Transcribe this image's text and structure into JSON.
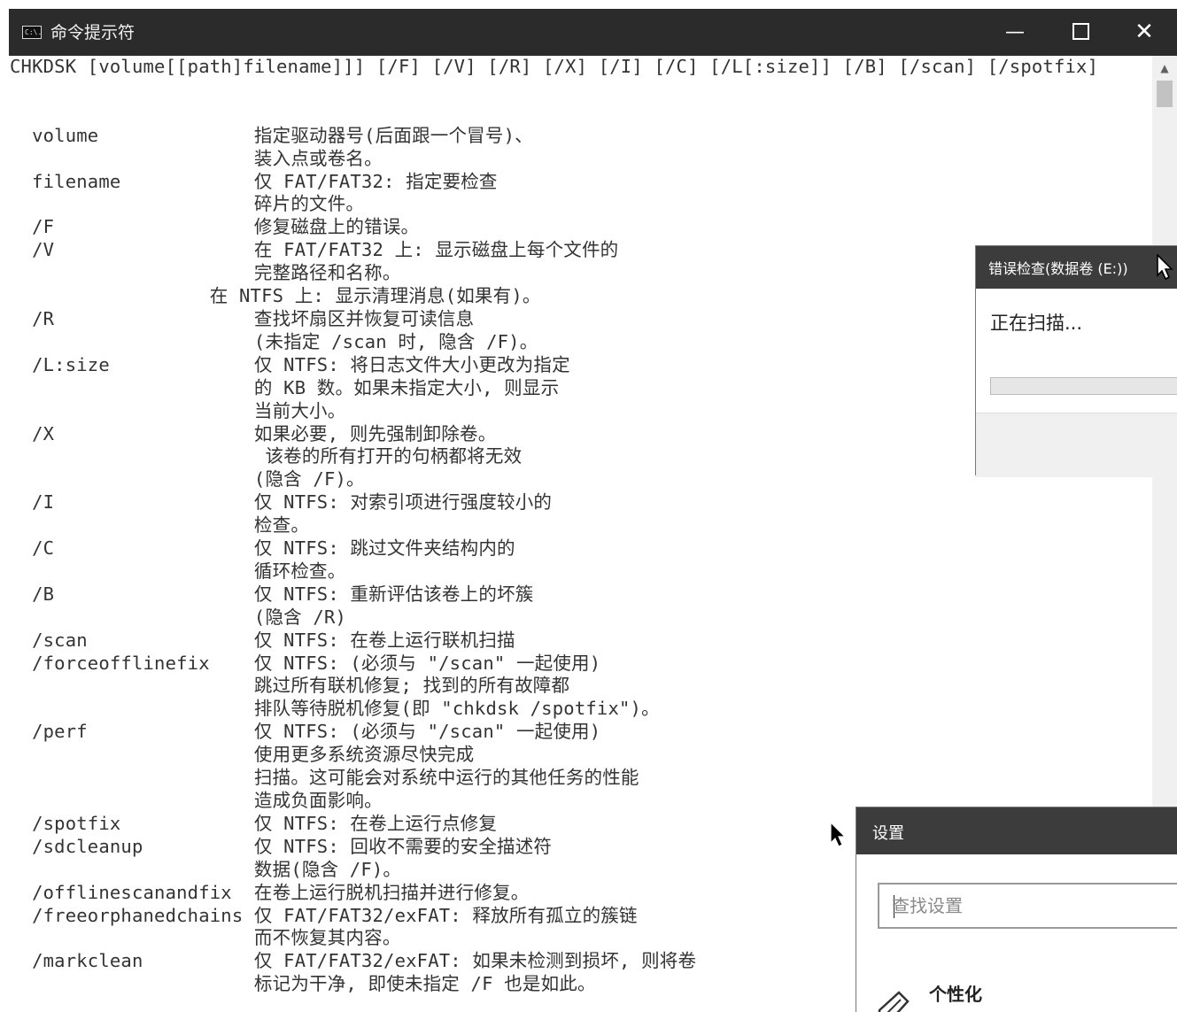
{
  "window": {
    "icon_text": "C:\\.",
    "title": "命令提示符",
    "minimize_glyph": "—",
    "close_glyph": "✕"
  },
  "console": {
    "lines": [
      "CHKDSK [volume[[path]filename]]] [/F] [/V] [/R] [/X] [/I] [/C] [/L[:size]] [/B] [/scan] [/spotfix]",
      "",
      "",
      "  volume              指定驱动器号(后面跟一个冒号)、",
      "                      装入点或卷名。",
      "  filename            仅 FAT/FAT32: 指定要检查",
      "                      碎片的文件。",
      "  /F                  修复磁盘上的错误。",
      "  /V                  在 FAT/FAT32 上: 显示磁盘上每个文件的",
      "                      完整路径和名称。",
      "                  在 NTFS 上: 显示清理消息(如果有)。",
      "  /R                  查找坏扇区并恢复可读信息",
      "                      (未指定 /scan 时, 隐含 /F)。",
      "  /L:size             仅 NTFS: 将日志文件大小更改为指定",
      "                      的 KB 数。如果未指定大小, 则显示",
      "                      当前大小。",
      "  /X                  如果必要, 则先强制卸除卷。",
      "                       该卷的所有打开的句柄都将无效",
      "                      (隐含 /F)。",
      "  /I                  仅 NTFS: 对索引项进行强度较小的",
      "                      检查。",
      "  /C                  仅 NTFS: 跳过文件夹结构内的",
      "                      循环检查。",
      "  /B                  仅 NTFS: 重新评估该卷上的坏簇",
      "                      (隐含 /R)",
      "  /scan               仅 NTFS: 在卷上运行联机扫描",
      "  /forceofflinefix    仅 NTFS: (必须与 \"/scan\" 一起使用)",
      "                      跳过所有联机修复; 找到的所有故障都",
      "                      排队等待脱机修复(即 \"chkdsk /spotfix\")。",
      "  /perf               仅 NTFS: (必须与 \"/scan\" 一起使用)",
      "                      使用更多系统资源尽快完成",
      "                      扫描。这可能会对系统中运行的其他任务的性能",
      "                      造成负面影响。",
      "  /spotfix            仅 NTFS: 在卷上运行点修复",
      "  /sdcleanup          仅 NTFS: 回收不需要的安全描述符",
      "                      数据(隐含 /F)。",
      "  /offlinescanandfix  在卷上运行脱机扫描并进行修复。",
      "  /freeorphanedchains 仅 FAT/FAT32/exFAT: 释放所有孤立的簇链",
      "                      而不恢复其内容。",
      "  /markclean          仅 FAT/FAT32/exFAT: 如果未检测到损坏, 则将卷",
      "                      标记为干净, 即使未指定 /F 也是如此。"
    ]
  },
  "scrollbar": {
    "up_glyph": "▲"
  },
  "error_check_dialog": {
    "title": "错误检查(数据卷 (E:))",
    "status": "正在扫描...",
    "progress": 0.0
  },
  "settings_dialog": {
    "title": "设置",
    "search_placeholder": "查找设置",
    "item_label": "个性化",
    "item_icon": "paint-brush-icon"
  }
}
